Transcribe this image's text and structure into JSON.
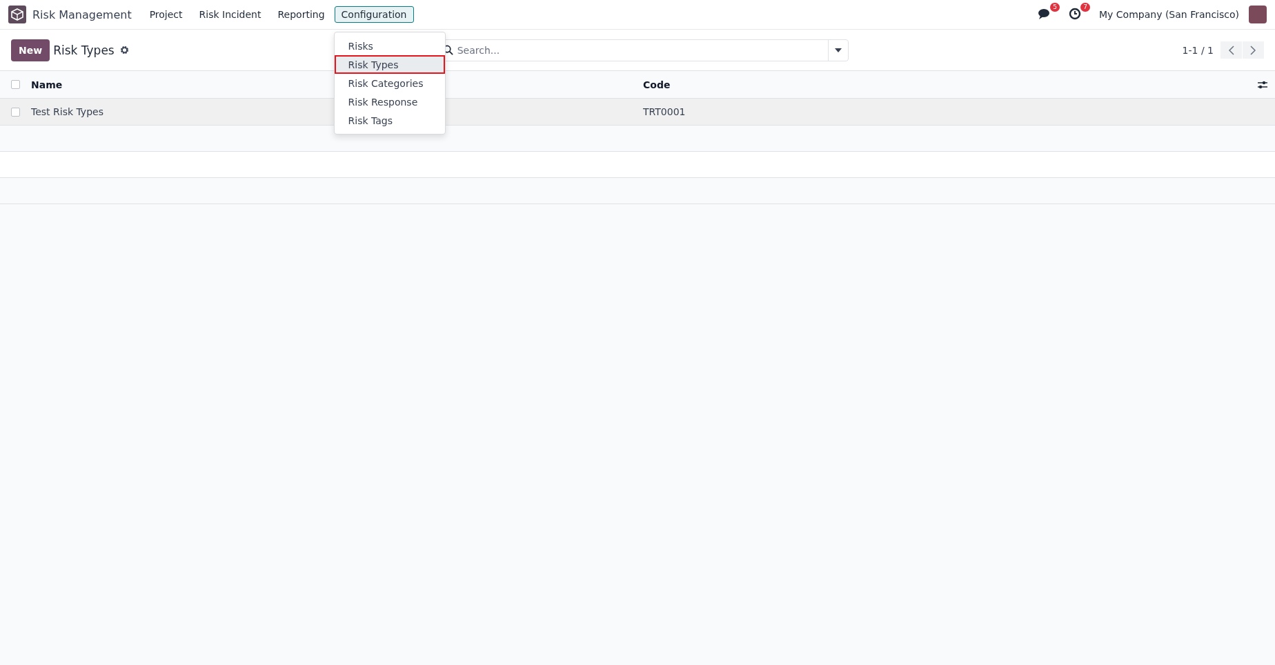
{
  "navbar": {
    "app_name": "Risk Management",
    "menus": [
      {
        "label": "Project",
        "selected": false
      },
      {
        "label": "Risk Incident",
        "selected": false
      },
      {
        "label": "Reporting",
        "selected": false
      },
      {
        "label": "Configuration",
        "selected": true
      }
    ],
    "dropdown": [
      {
        "label": "Risks",
        "selected": false
      },
      {
        "label": "Risk Types",
        "selected": true
      },
      {
        "label": "Risk Categories",
        "selected": false
      },
      {
        "label": "Risk Response",
        "selected": false
      },
      {
        "label": "Risk Tags",
        "selected": false
      }
    ],
    "messages_badge": "5",
    "activities_badge": "7",
    "company": "My Company (San Francisco)"
  },
  "control_panel": {
    "new_button": "New",
    "title": "Risk Types",
    "search": {
      "placeholder": "Search..."
    },
    "pager": "1-1 / 1"
  },
  "table": {
    "all_checked": false,
    "columns": [
      "Name",
      "Code"
    ],
    "rows": [
      {
        "cells": [
          "Test Risk Types",
          "TRT0001"
        ],
        "checked": false
      }
    ]
  }
}
